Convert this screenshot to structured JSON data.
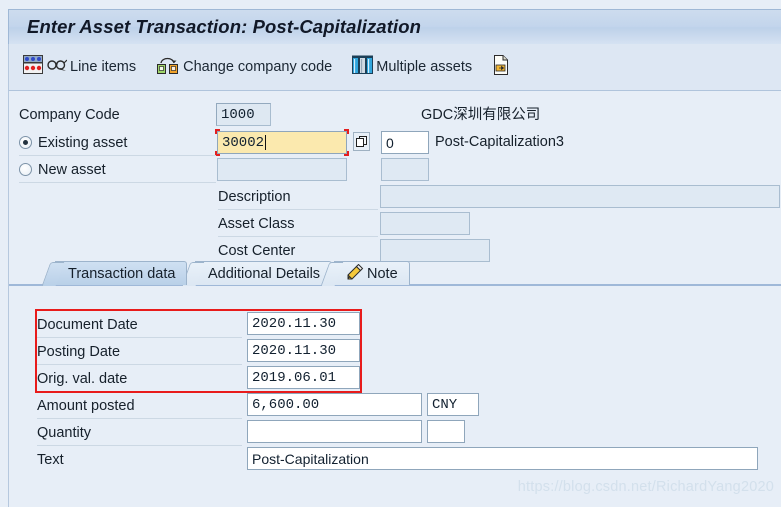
{
  "window": {
    "title": "Enter Asset Transaction: Post-Capitalization"
  },
  "toolbar": {
    "buttons": [
      {
        "label": "Line items",
        "icon": "line-items-icon"
      },
      {
        "label": "Change company code",
        "icon": "change-company-code-icon"
      },
      {
        "label": "Multiple assets",
        "icon": "multiple-assets-icon"
      },
      {
        "label": "",
        "icon": "document-export-icon"
      }
    ]
  },
  "header_form": {
    "company_code_label": "Company Code",
    "company_code_value": "1000",
    "company_name": "GDC深圳有限公司",
    "existing_asset_label": "Existing asset",
    "existing_asset_value": "30002",
    "existing_asset_selected": true,
    "subnumber_value": "0",
    "asset_description": "Post-Capitalization3",
    "new_asset_label": "New asset",
    "new_asset_value": "",
    "new_asset_subnumber": "",
    "new_asset_selected": false,
    "description_label": "Description",
    "description_value": "",
    "asset_class_label": "Asset Class",
    "asset_class_value": "",
    "cost_center_label": "Cost Center",
    "cost_center_value": ""
  },
  "tabs": [
    {
      "label": "Transaction data",
      "active": true,
      "icon": ""
    },
    {
      "label": "Additional Details",
      "active": false,
      "icon": ""
    },
    {
      "label": "Note",
      "active": false,
      "icon": "note-pencil-icon"
    }
  ],
  "transaction_data": {
    "rows": [
      {
        "label": "Document Date",
        "value": "2020.11.30",
        "unit": "",
        "highlight": true
      },
      {
        "label": "Posting Date",
        "value": "2020.11.30",
        "unit": "",
        "highlight": true
      },
      {
        "label": "Orig. val. date",
        "value": "2019.06.01",
        "unit": "",
        "highlight": true
      },
      {
        "label": "Amount posted",
        "value": "6,600.00",
        "unit": "CNY",
        "highlight": false
      },
      {
        "label": "Quantity",
        "value": "",
        "unit": "",
        "highlight": false
      },
      {
        "label": "Text",
        "value": "Post-Capitalization",
        "unit": "",
        "highlight": false
      }
    ]
  },
  "watermark": {
    "text": "https://blog.csdn.net/RichardYang2020"
  },
  "colors": {
    "title_bar": "#c3d5ec",
    "toolbar": "#dde7f3",
    "content": "#e7eef7",
    "focus_field": "#fbe9ae",
    "focus_marker": "#e81b1b",
    "highlight_box": "#e81b1b"
  }
}
